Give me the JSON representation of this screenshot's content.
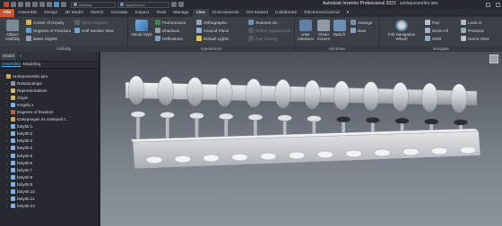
{
  "app": {
    "title": "Autodesk Inventor Professional 2021",
    "file": "szelepvezerlés.iam",
    "material_combo": "Material",
    "appearance_combo": "Appearance"
  },
  "tabs": {
    "file": "File",
    "items": [
      "Assemble",
      "Design",
      "3D Model",
      "Sketch",
      "Annotate",
      "Inspect",
      "Tools",
      "Manage",
      "View",
      "Environments",
      "Get Started",
      "Collaborate",
      "Electromechanical"
    ],
    "active": "View"
  },
  "ribbon": {
    "visibility": {
      "title": "Visibility",
      "object_visibility": "Object Visibility",
      "center_of_gravity": "Center of Gravity",
      "degrees_of_freedom": "Degrees of Freedom",
      "imate_glyphs": "iMate Glyphs",
      "slice_graphics": "Slice Graphics",
      "half_section_view": "Half Section View"
    },
    "appearance": {
      "title": "Appearance",
      "visual_style": "Visual Style",
      "performance": "Performance",
      "shadows": "Shadows",
      "reflections": "Reflections",
      "orthographic": "Orthographic",
      "ground_plane": "Ground Plane",
      "default_lights": "Default Lights",
      "textures_on": "Textures On",
      "refine_appearance": "Refine Appearance",
      "ray_tracing": "Ray Tracing"
    },
    "windows": {
      "title": "Windows",
      "user_interface": "User Interface",
      "clean_screen": "Clean Screen",
      "switch": "Switch",
      "arrange": "Arrange",
      "new": "New"
    },
    "navigate": {
      "title": "Navigate",
      "full_navigation_wheel": "Full Navigation Wheel",
      "pan": "Pan",
      "zoom_all": "Zoom All",
      "orbit": "Orbit",
      "look_at": "Look At",
      "previous": "Previous",
      "home_view": "Home View"
    }
  },
  "browser": {
    "tab_model": "Model",
    "tab_plus": "+",
    "sub_assembly": "Assembly",
    "sub_modeling": "Modeling",
    "items": [
      {
        "label": "szelepvezerlés.iam",
        "depth": 0,
        "icon": "assembly-icon"
      },
      {
        "label": "Relationships",
        "depth": 1,
        "icon": "relationships-icon"
      },
      {
        "label": "Representations",
        "depth": 1,
        "icon": "folder-icon"
      },
      {
        "label": "Origin",
        "depth": 1,
        "icon": "folder-icon"
      },
      {
        "label": "tengely:1",
        "depth": 1,
        "icon": "part-icon"
      },
      {
        "label": "Degrees of freedom",
        "depth": 1,
        "icon": "dof-icon"
      },
      {
        "label": "szelepvegek és szelepek:1",
        "depth": 1,
        "icon": "assembly-icon"
      },
      {
        "label": "bütyök:1",
        "depth": 1,
        "icon": "part-icon"
      },
      {
        "label": "bütyök:2",
        "depth": 1,
        "icon": "part-icon"
      },
      {
        "label": "bütyök:3",
        "depth": 1,
        "icon": "part-icon"
      },
      {
        "label": "bütyök:4",
        "depth": 1,
        "icon": "part-icon"
      },
      {
        "label": "bütyök:5",
        "depth": 1,
        "icon": "part-icon"
      },
      {
        "label": "bütyök:6",
        "depth": 1,
        "icon": "part-icon"
      },
      {
        "label": "bütyök:7",
        "depth": 1,
        "icon": "part-icon"
      },
      {
        "label": "bütyök:8",
        "depth": 1,
        "icon": "part-icon"
      },
      {
        "label": "bütyök:9",
        "depth": 1,
        "icon": "part-icon"
      },
      {
        "label": "bütyök:10",
        "depth": 1,
        "icon": "part-icon"
      },
      {
        "label": "bütyök:11",
        "depth": 1,
        "icon": "part-icon"
      },
      {
        "label": "bütyök:12",
        "depth": 1,
        "icon": "part-icon"
      }
    ]
  },
  "colors": {
    "file_tab": "#c8582a",
    "accent_blue": "#4c8fd2",
    "valve_green": "#4f8a2a"
  }
}
